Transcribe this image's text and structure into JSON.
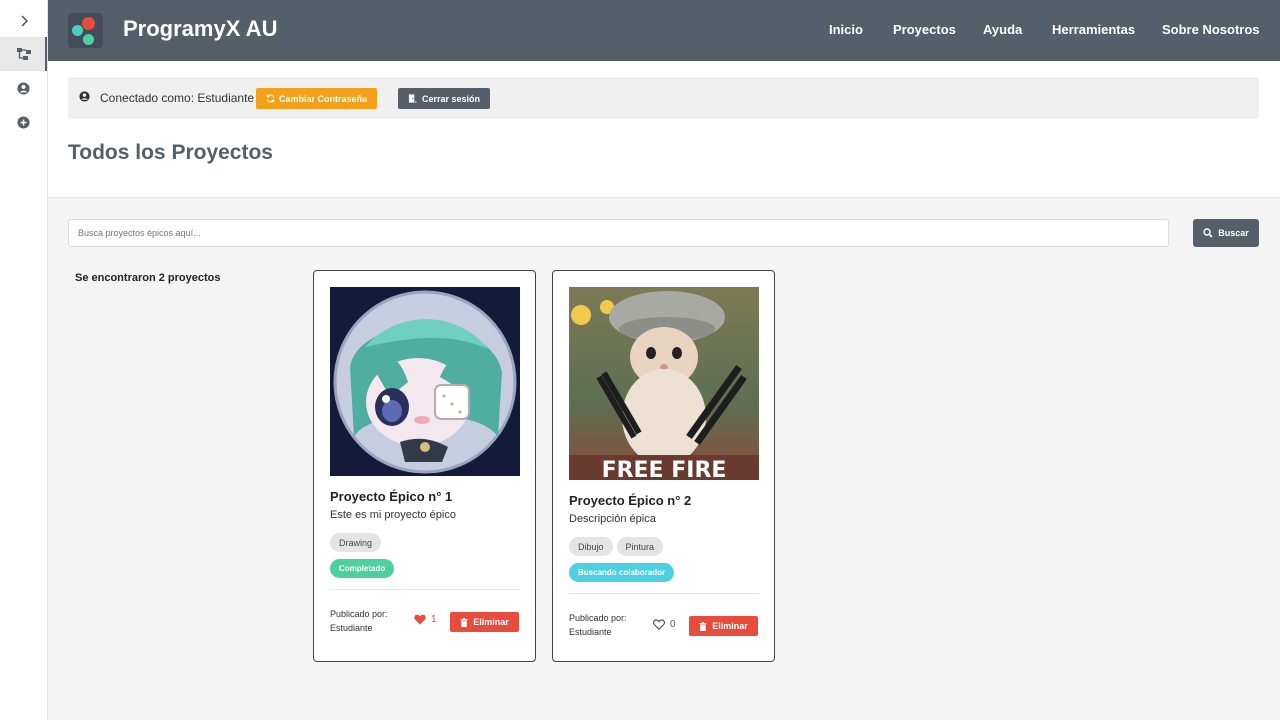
{
  "app": {
    "brand": "ProgramyX AU",
    "logo_colors": [
      "#e74c3c",
      "#4ecdc4",
      "#4cd19e"
    ]
  },
  "rail": {
    "items": [
      {
        "icon": "chevron-right-icon"
      },
      {
        "icon": "sitemap-icon",
        "active": true
      },
      {
        "icon": "user-circle-icon"
      },
      {
        "icon": "plus-circle-icon"
      }
    ]
  },
  "nav": {
    "items": [
      "Inicio",
      "Proyectos",
      "Ayuda",
      "Herramientas",
      "Sobre Nosotros"
    ]
  },
  "userbar": {
    "status": "Conectado como: Estudiante",
    "change_password": "Cambiar Contraseña",
    "logout": "Cerrar sesión"
  },
  "page": {
    "title": "Todos los Proyectos"
  },
  "search": {
    "placeholder": "Busca proyectos épicos aquí...",
    "value": "",
    "button": "Buscar"
  },
  "results": {
    "text": "Se encontraron 2 proyectos"
  },
  "projects": [
    {
      "title": "Proyecto Épico n° 1",
      "description": "Este es mi proyecto épico",
      "tags": [
        "Drawing"
      ],
      "status": "Completado",
      "status_color": "#4cd19e",
      "published_label": "Publicado por:",
      "author": "Estudiante",
      "likes": "1",
      "liked": true,
      "delete_label": "Eliminar"
    },
    {
      "title": "Proyecto Épico n° 2",
      "description": "Descripción épica",
      "tags": [
        "Dibujo",
        "Pintura"
      ],
      "status": "Buscando colaborador",
      "status_color": "#4dd0e1",
      "published_label": "Publicado por:",
      "author": "Estudiante",
      "likes": "0",
      "liked": false,
      "delete_label": "Eliminar",
      "image_caption": "FREE FIRE"
    }
  ],
  "colors": {
    "primary": "#555f69",
    "warning": "#f5a01a",
    "danger": "#e74c3c"
  }
}
